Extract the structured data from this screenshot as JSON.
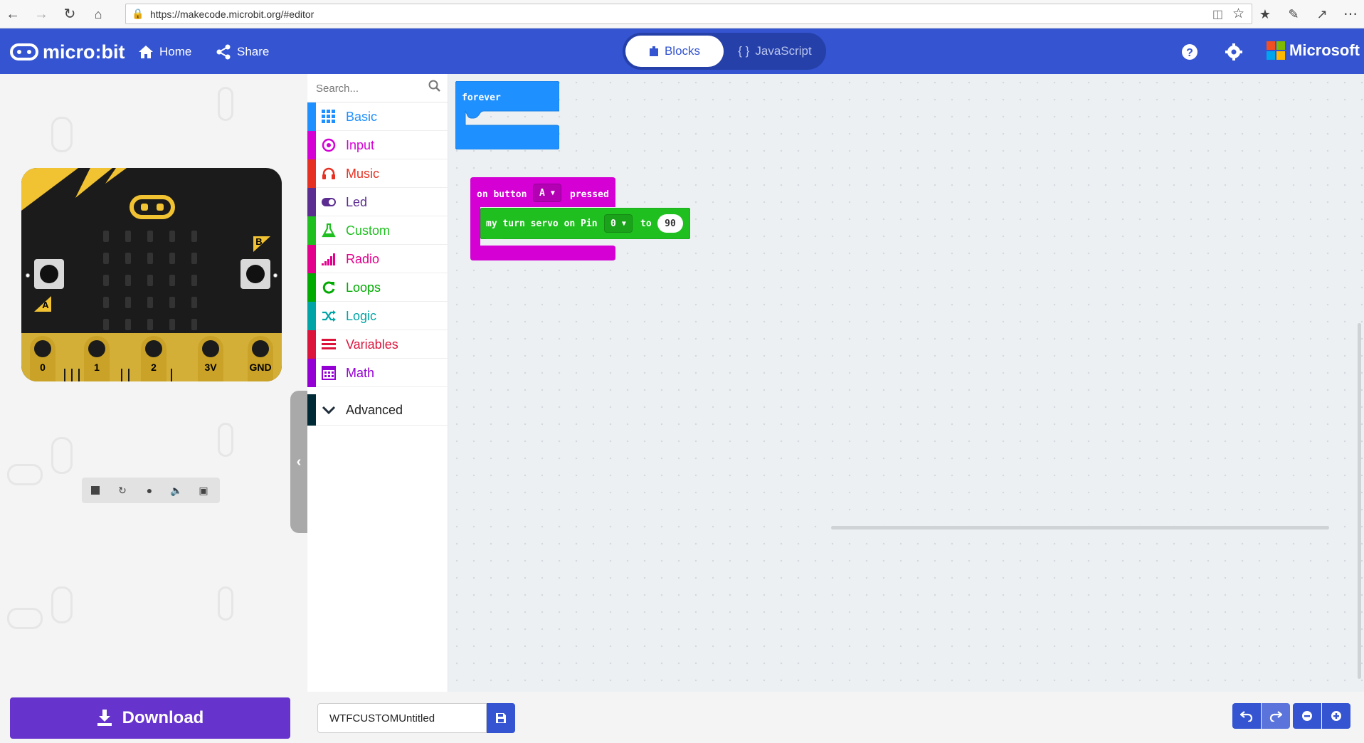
{
  "browser": {
    "url": "https://makecode.microbit.org/#editor"
  },
  "header": {
    "logo_text": "micro:bit",
    "home_label": "Home",
    "share_label": "Share",
    "tabs": [
      {
        "label": "Blocks",
        "active": true
      },
      {
        "label": "JavaScript",
        "active": false
      }
    ],
    "brand": "Microsoft"
  },
  "simulator": {
    "button_a": "A",
    "button_b": "B",
    "pins": [
      "0",
      "1",
      "2",
      "3V",
      "GND"
    ]
  },
  "toolbox": {
    "search_placeholder": "Search...",
    "categories": [
      {
        "label": "Basic",
        "color": "#1e90ff",
        "icon": "grid-icon"
      },
      {
        "label": "Input",
        "color": "#d400d4",
        "icon": "target-icon"
      },
      {
        "label": "Music",
        "color": "#e63022",
        "icon": "headphones-icon"
      },
      {
        "label": "Led",
        "color": "#5c2d91",
        "icon": "toggle-icon"
      },
      {
        "label": "Custom",
        "color": "#20bf20",
        "icon": "flask-icon"
      },
      {
        "label": "Radio",
        "color": "#e3008c",
        "icon": "signal-icon"
      },
      {
        "label": "Loops",
        "color": "#00aa00",
        "icon": "refresh-icon"
      },
      {
        "label": "Logic",
        "color": "#00a4a6",
        "icon": "shuffle-icon"
      },
      {
        "label": "Variables",
        "color": "#dc143c",
        "icon": "list-icon"
      },
      {
        "label": "Math",
        "color": "#9400d3",
        "icon": "calculator-icon"
      }
    ],
    "advanced_label": "Advanced"
  },
  "workspace": {
    "forever_block": {
      "label": "forever",
      "color": "#1e90ff"
    },
    "event_block": {
      "prefix": "on button",
      "button_value": "A",
      "suffix": "pressed",
      "color": "#d400d4"
    },
    "servo_block": {
      "prefix": "my turn servo on Pin",
      "pin_value": "0",
      "to_label": "to",
      "angle_value": "90",
      "color": "#20bf20"
    }
  },
  "bottom": {
    "download_label": "Download",
    "project_name": "WTFCUSTOMUntitled"
  }
}
